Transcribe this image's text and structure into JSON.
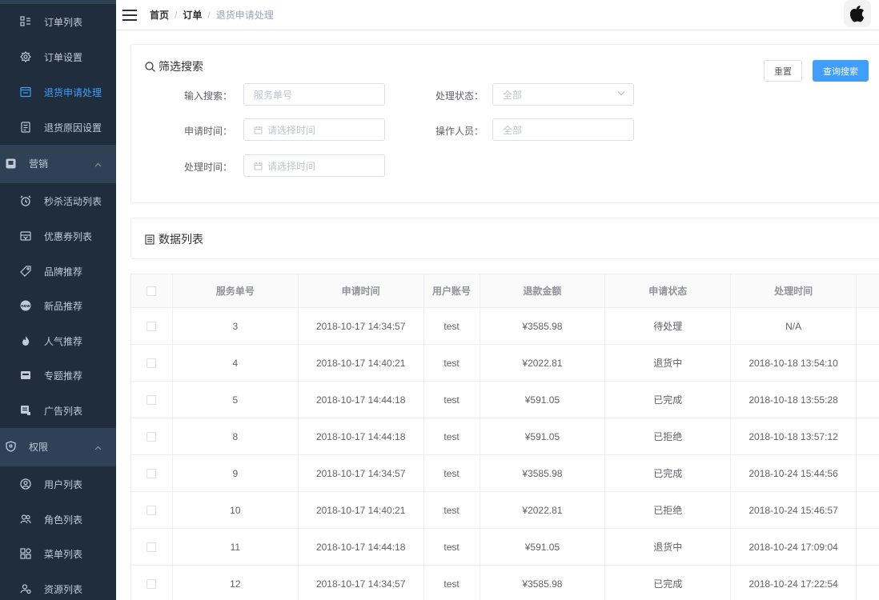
{
  "sidebar": {
    "items": [
      {
        "label": "订单列表",
        "icon": "order-list-icon",
        "type": "sub"
      },
      {
        "label": "订单设置",
        "icon": "order-setting-icon",
        "type": "sub"
      },
      {
        "label": "退货申请处理",
        "icon": "return-apply-icon",
        "type": "sub",
        "active": true
      },
      {
        "label": "退货原因设置",
        "icon": "return-reason-icon",
        "type": "sub"
      },
      {
        "label": "营销",
        "icon": "marketing-icon",
        "type": "group"
      },
      {
        "label": "秒杀活动列表",
        "icon": "alarm-clock-icon",
        "type": "sub"
      },
      {
        "label": "优惠券列表",
        "icon": "coupon-icon",
        "type": "sub"
      },
      {
        "label": "品牌推荐",
        "icon": "tag-icon",
        "type": "sub"
      },
      {
        "label": "新品推荐",
        "icon": "new-icon",
        "type": "sub"
      },
      {
        "label": "人气推荐",
        "icon": "fire-icon",
        "type": "sub"
      },
      {
        "label": "专题推荐",
        "icon": "topic-icon",
        "type": "sub"
      },
      {
        "label": "广告列表",
        "icon": "ad-icon",
        "type": "sub"
      },
      {
        "label": "权限",
        "icon": "shield-icon",
        "type": "group"
      },
      {
        "label": "用户列表",
        "icon": "user-icon",
        "type": "sub"
      },
      {
        "label": "角色列表",
        "icon": "role-icon",
        "type": "sub"
      },
      {
        "label": "菜单列表",
        "icon": "menu-grid-icon",
        "type": "sub"
      },
      {
        "label": "资源列表",
        "icon": "resource-icon",
        "type": "sub"
      }
    ]
  },
  "header": {
    "breadcrumb": [
      "首页",
      "订单",
      "退货申请处理"
    ]
  },
  "filter": {
    "title": "筛选搜索",
    "reset_label": "重置",
    "search_label": "查询搜索",
    "keyword_label": "输入搜索：",
    "keyword_placeholder": "服务单号",
    "status_label": "处理状态：",
    "status_value": "全部",
    "apply_time_label": "申请时间：",
    "apply_time_placeholder": "请选择时间",
    "operator_label": "操作人员：",
    "operator_placeholder": "全部",
    "handle_time_label": "处理时间：",
    "handle_time_placeholder": "请选择时间"
  },
  "list": {
    "title": "数据列表"
  },
  "table": {
    "columns": [
      "服务单号",
      "申请时间",
      "用户账号",
      "退款金额",
      "申请状态",
      "处理时间"
    ],
    "rows": [
      [
        "3",
        "2018-10-17 14:34:57",
        "test",
        "¥3585.98",
        "待处理",
        "N/A"
      ],
      [
        "4",
        "2018-10-17 14:40:21",
        "test",
        "¥2022.81",
        "退货中",
        "2018-10-18 13:54:10"
      ],
      [
        "5",
        "2018-10-17 14:44:18",
        "test",
        "¥591.05",
        "已完成",
        "2018-10-18 13:55:28"
      ],
      [
        "8",
        "2018-10-17 14:44:18",
        "test",
        "¥591.05",
        "已拒绝",
        "2018-10-18 13:57:12"
      ],
      [
        "9",
        "2018-10-17 14:34:57",
        "test",
        "¥3585.98",
        "已完成",
        "2018-10-24 15:44:56"
      ],
      [
        "10",
        "2018-10-17 14:40:21",
        "test",
        "¥2022.81",
        "已拒绝",
        "2018-10-24 15:46:57"
      ],
      [
        "11",
        "2018-10-17 14:44:18",
        "test",
        "¥591.05",
        "退货中",
        "2018-10-24 17:09:04"
      ],
      [
        "12",
        "2018-10-17 14:34:57",
        "test",
        "¥3585.98",
        "已完成",
        "2018-10-24 17:22:54"
      ]
    ]
  },
  "colors": {
    "sidebar_bg": "#304156",
    "submenu_bg": "#1f2d3d",
    "accent": "#409EFF",
    "menu_text": "#bfcbd9"
  }
}
